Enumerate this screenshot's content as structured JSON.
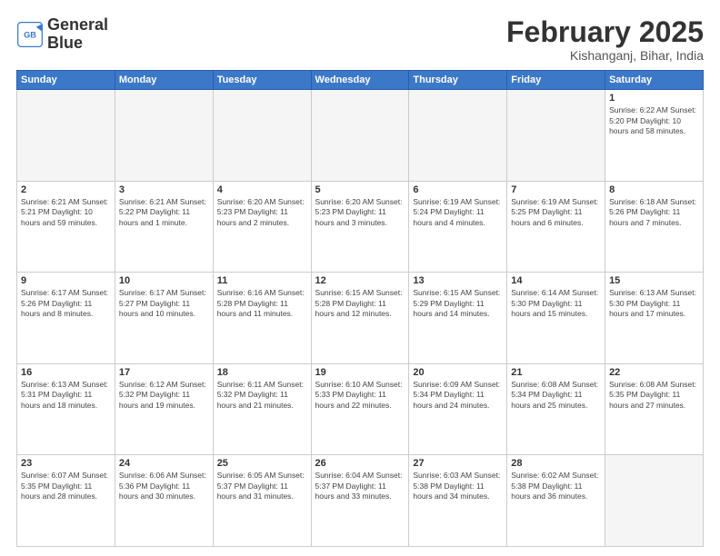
{
  "logo": {
    "line1": "General",
    "line2": "Blue"
  },
  "title": "February 2025",
  "location": "Kishanganj, Bihar, India",
  "weekdays": [
    "Sunday",
    "Monday",
    "Tuesday",
    "Wednesday",
    "Thursday",
    "Friday",
    "Saturday"
  ],
  "weeks": [
    [
      {
        "day": "",
        "info": ""
      },
      {
        "day": "",
        "info": ""
      },
      {
        "day": "",
        "info": ""
      },
      {
        "day": "",
        "info": ""
      },
      {
        "day": "",
        "info": ""
      },
      {
        "day": "",
        "info": ""
      },
      {
        "day": "1",
        "info": "Sunrise: 6:22 AM\nSunset: 5:20 PM\nDaylight: 10 hours\nand 58 minutes."
      }
    ],
    [
      {
        "day": "2",
        "info": "Sunrise: 6:21 AM\nSunset: 5:21 PM\nDaylight: 10 hours\nand 59 minutes."
      },
      {
        "day": "3",
        "info": "Sunrise: 6:21 AM\nSunset: 5:22 PM\nDaylight: 11 hours\nand 1 minute."
      },
      {
        "day": "4",
        "info": "Sunrise: 6:20 AM\nSunset: 5:23 PM\nDaylight: 11 hours\nand 2 minutes."
      },
      {
        "day": "5",
        "info": "Sunrise: 6:20 AM\nSunset: 5:23 PM\nDaylight: 11 hours\nand 3 minutes."
      },
      {
        "day": "6",
        "info": "Sunrise: 6:19 AM\nSunset: 5:24 PM\nDaylight: 11 hours\nand 4 minutes."
      },
      {
        "day": "7",
        "info": "Sunrise: 6:19 AM\nSunset: 5:25 PM\nDaylight: 11 hours\nand 6 minutes."
      },
      {
        "day": "8",
        "info": "Sunrise: 6:18 AM\nSunset: 5:26 PM\nDaylight: 11 hours\nand 7 minutes."
      }
    ],
    [
      {
        "day": "9",
        "info": "Sunrise: 6:17 AM\nSunset: 5:26 PM\nDaylight: 11 hours\nand 8 minutes."
      },
      {
        "day": "10",
        "info": "Sunrise: 6:17 AM\nSunset: 5:27 PM\nDaylight: 11 hours\nand 10 minutes."
      },
      {
        "day": "11",
        "info": "Sunrise: 6:16 AM\nSunset: 5:28 PM\nDaylight: 11 hours\nand 11 minutes."
      },
      {
        "day": "12",
        "info": "Sunrise: 6:15 AM\nSunset: 5:28 PM\nDaylight: 11 hours\nand 12 minutes."
      },
      {
        "day": "13",
        "info": "Sunrise: 6:15 AM\nSunset: 5:29 PM\nDaylight: 11 hours\nand 14 minutes."
      },
      {
        "day": "14",
        "info": "Sunrise: 6:14 AM\nSunset: 5:30 PM\nDaylight: 11 hours\nand 15 minutes."
      },
      {
        "day": "15",
        "info": "Sunrise: 6:13 AM\nSunset: 5:30 PM\nDaylight: 11 hours\nand 17 minutes."
      }
    ],
    [
      {
        "day": "16",
        "info": "Sunrise: 6:13 AM\nSunset: 5:31 PM\nDaylight: 11 hours\nand 18 minutes."
      },
      {
        "day": "17",
        "info": "Sunrise: 6:12 AM\nSunset: 5:32 PM\nDaylight: 11 hours\nand 19 minutes."
      },
      {
        "day": "18",
        "info": "Sunrise: 6:11 AM\nSunset: 5:32 PM\nDaylight: 11 hours\nand 21 minutes."
      },
      {
        "day": "19",
        "info": "Sunrise: 6:10 AM\nSunset: 5:33 PM\nDaylight: 11 hours\nand 22 minutes."
      },
      {
        "day": "20",
        "info": "Sunrise: 6:09 AM\nSunset: 5:34 PM\nDaylight: 11 hours\nand 24 minutes."
      },
      {
        "day": "21",
        "info": "Sunrise: 6:08 AM\nSunset: 5:34 PM\nDaylight: 11 hours\nand 25 minutes."
      },
      {
        "day": "22",
        "info": "Sunrise: 6:08 AM\nSunset: 5:35 PM\nDaylight: 11 hours\nand 27 minutes."
      }
    ],
    [
      {
        "day": "23",
        "info": "Sunrise: 6:07 AM\nSunset: 5:35 PM\nDaylight: 11 hours\nand 28 minutes."
      },
      {
        "day": "24",
        "info": "Sunrise: 6:06 AM\nSunset: 5:36 PM\nDaylight: 11 hours\nand 30 minutes."
      },
      {
        "day": "25",
        "info": "Sunrise: 6:05 AM\nSunset: 5:37 PM\nDaylight: 11 hours\nand 31 minutes."
      },
      {
        "day": "26",
        "info": "Sunrise: 6:04 AM\nSunset: 5:37 PM\nDaylight: 11 hours\nand 33 minutes."
      },
      {
        "day": "27",
        "info": "Sunrise: 6:03 AM\nSunset: 5:38 PM\nDaylight: 11 hours\nand 34 minutes."
      },
      {
        "day": "28",
        "info": "Sunrise: 6:02 AM\nSunset: 5:38 PM\nDaylight: 11 hours\nand 36 minutes."
      },
      {
        "day": "",
        "info": ""
      }
    ]
  ]
}
